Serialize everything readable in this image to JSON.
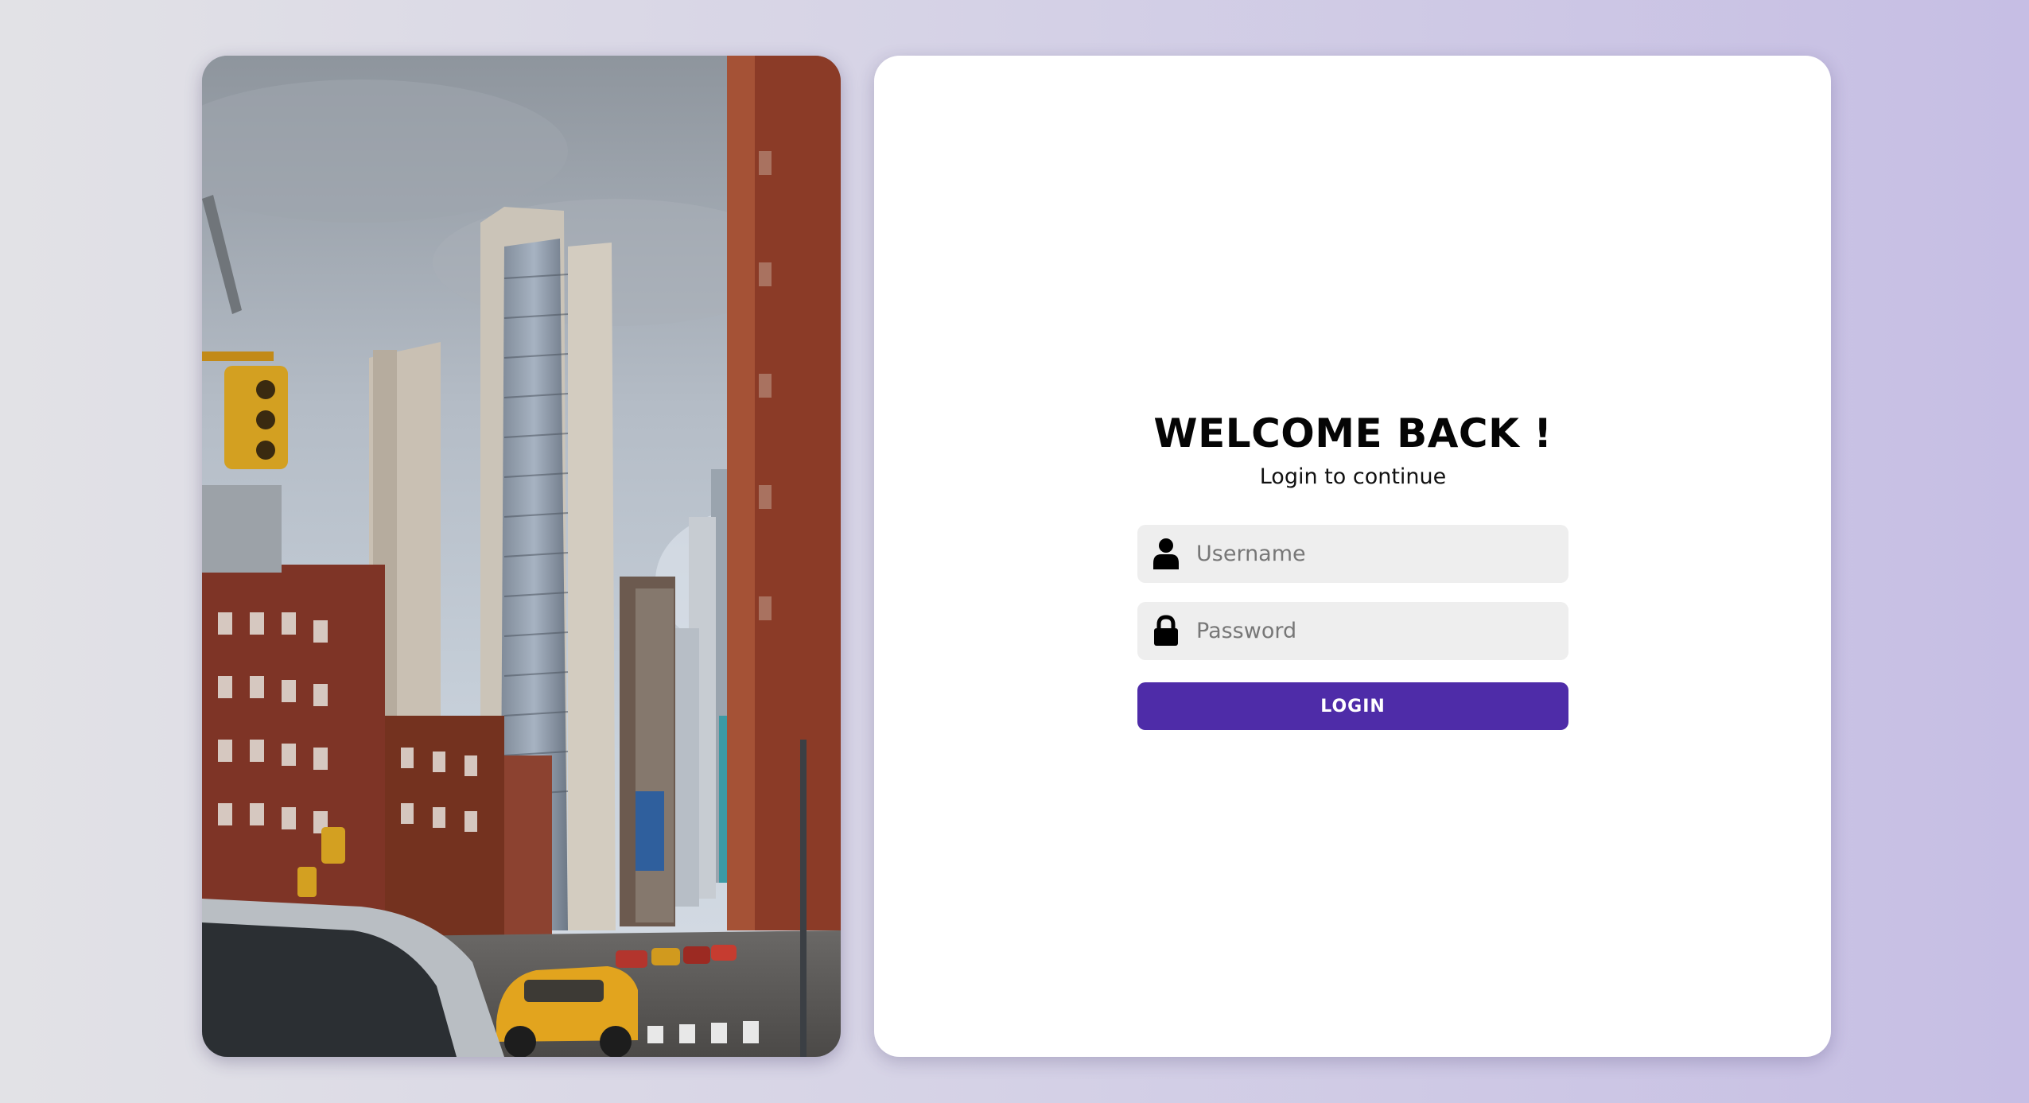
{
  "login": {
    "title": "WELCOME BACK !",
    "subtitle": "Login to continue",
    "username": {
      "placeholder": "Username",
      "value": "",
      "icon": "user-icon"
    },
    "password": {
      "placeholder": "Password",
      "value": "",
      "icon": "lock-icon"
    },
    "submit_label": "LOGIN"
  },
  "image": {
    "subject": "city street with skyscrapers and yellow taxis"
  },
  "colors": {
    "accent": "#4e2ca8",
    "card": "#ffffff",
    "field_bg": "#eeeeee",
    "background_left": "#e2e2e6",
    "background_right": "#c6bee4"
  }
}
